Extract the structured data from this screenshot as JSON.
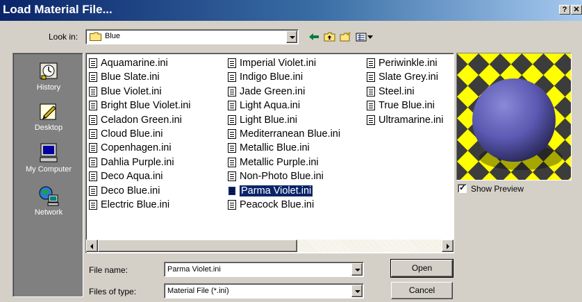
{
  "window": {
    "title": "Load Material File...",
    "help_label": "?",
    "close_label": "✕"
  },
  "lookin": {
    "label": "Look in:",
    "value": "Blue"
  },
  "toolbar": {
    "back_icon": "back-arrow-icon",
    "up_icon": "up-folder-icon",
    "new_icon": "new-folder-icon",
    "view_icon": "view-menu-icon"
  },
  "places": [
    {
      "label": "History",
      "icon": "history-icon"
    },
    {
      "label": "Desktop",
      "icon": "desktop-icon"
    },
    {
      "label": "My Computer",
      "icon": "my-computer-icon"
    },
    {
      "label": "Network",
      "icon": "network-icon"
    }
  ],
  "files": {
    "columns": [
      [
        "Aquamarine.ini",
        "Blue Slate.ini",
        "Blue Violet.ini",
        "Bright Blue Violet.ini",
        "Celadon Green.ini",
        "Cloud Blue.ini",
        "Copenhagen.ini",
        "Dahlia Purple.ini",
        "Deco Aqua.ini",
        "Deco Blue.ini",
        "Electric Blue.ini"
      ],
      [
        "Imperial Violet.ini",
        "Indigo Blue.ini",
        "Jade Green.ini",
        "Light Aqua.ini",
        "Light Blue.ini",
        "Mediterranean Blue.ini",
        "Metallic Blue.ini",
        "Metallic Purple.ini",
        "Non-Photo Blue.ini",
        "Parma Violet.ini",
        "Peacock Blue.ini"
      ],
      [
        "Periwinkle.ini",
        "Slate Grey.ini",
        "Steel.ini",
        "True Blue.ini",
        "Ultramarine.ini"
      ]
    ],
    "selected": "Parma Violet.ini"
  },
  "preview": {
    "show_label": "Show Preview",
    "checked": true
  },
  "filename": {
    "label": "File name:",
    "value": "Parma Violet.ini"
  },
  "filetype": {
    "label": "Files of type:",
    "value": "Material File (*.ini)"
  },
  "buttons": {
    "open": "Open",
    "cancel": "Cancel"
  },
  "colors": {
    "title_start": "#0a246a",
    "title_end": "#a6caf0",
    "dialog_bg": "#d4d0c8",
    "places_bg": "#808080",
    "selection": "#0a246a",
    "checker_yellow": "#ffff00",
    "checker_dark": "#3c3c3c",
    "sphere": "#5a58b0"
  }
}
